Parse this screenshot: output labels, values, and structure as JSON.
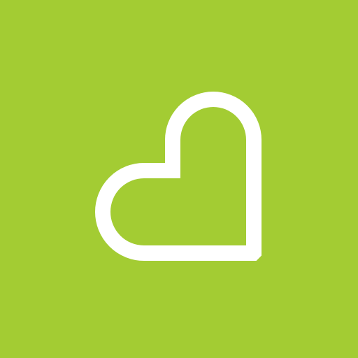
{
  "app_icon": {
    "icon": "heart-outline-icon",
    "background_color": "#A3CC33",
    "symbol_color": "#FFFFFF"
  }
}
